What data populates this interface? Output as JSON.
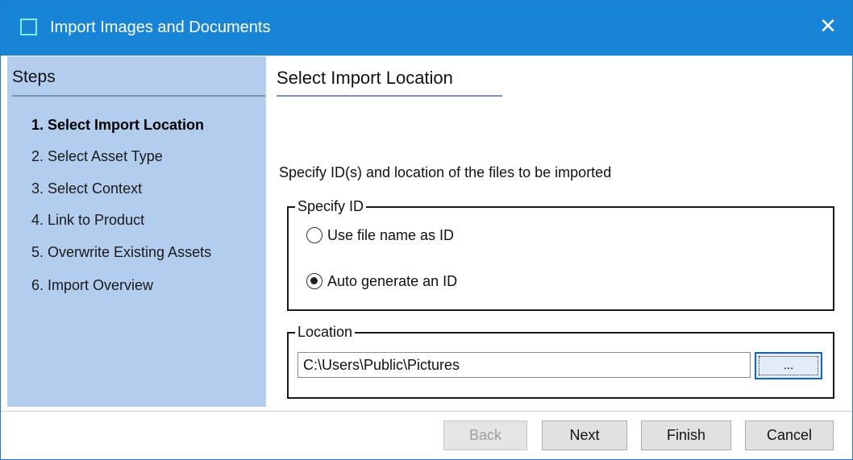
{
  "window": {
    "title": "Import Images and Documents",
    "close_symbol": "✕"
  },
  "steps": {
    "heading": "Steps",
    "items": [
      {
        "label": "1. Select Import Location",
        "current": true
      },
      {
        "label": "2. Select Asset Type",
        "current": false
      },
      {
        "label": "3. Select Context",
        "current": false
      },
      {
        "label": "4. Link to Product",
        "current": false
      },
      {
        "label": "5. Overwrite Existing Assets",
        "current": false
      },
      {
        "label": "6. Import Overview",
        "current": false
      }
    ]
  },
  "main": {
    "heading": "Select Import Location",
    "instruction": "Specify ID(s) and location of the files to be imported",
    "specify_id": {
      "legend": "Specify ID",
      "options": [
        {
          "label": "Use file name as ID",
          "selected": false
        },
        {
          "label": "Auto generate an ID",
          "selected": true
        }
      ]
    },
    "location": {
      "legend": "Location",
      "value": "C:\\Users\\Public\\Pictures",
      "browse_label": "..."
    }
  },
  "footer": {
    "back_label": "Back",
    "next_label": "Next",
    "finish_label": "Finish",
    "cancel_label": "Cancel",
    "back_disabled": true
  },
  "colors": {
    "titlebar": "#1884d6",
    "sidebar": "#b3cdee",
    "accent_border": "#1565c0"
  },
  "icons": {
    "app": "window-icon",
    "close": "close-icon"
  }
}
